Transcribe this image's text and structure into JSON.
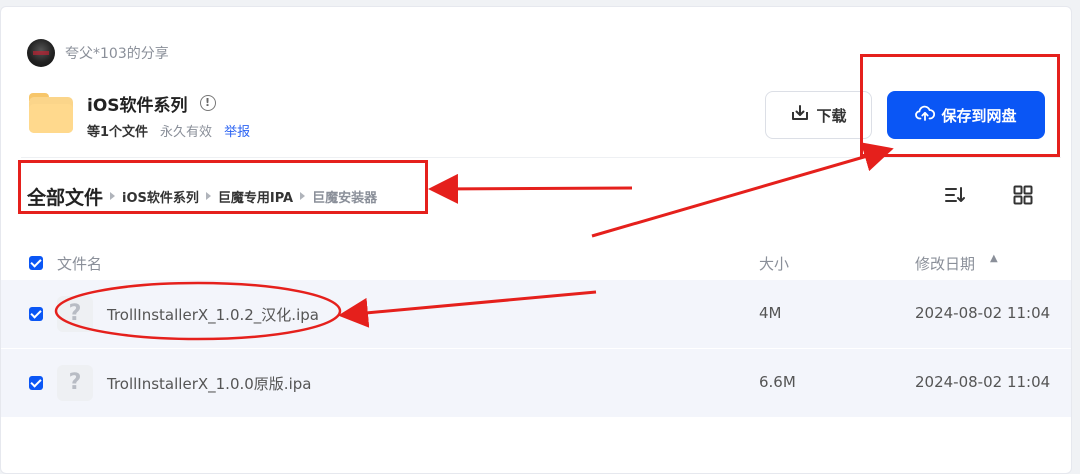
{
  "sharer": {
    "name": "夸父*103的分享"
  },
  "folder": {
    "title": "iOS软件系列",
    "file_count": "等1个文件",
    "validity": "永久有效",
    "report": "举报"
  },
  "actions": {
    "download_label": "下载",
    "save_label": "保存到网盘"
  },
  "breadcrumb": {
    "root": "全部文件",
    "items": [
      "iOS软件系列",
      "巨魔专用IPA",
      "巨魔安装器"
    ]
  },
  "table": {
    "headers": {
      "name": "文件名",
      "size": "大小",
      "date": "修改日期"
    },
    "rows": [
      {
        "name": "TrollInstallerX_1.0.2_汉化.ipa",
        "size": "4M",
        "date": "2024-08-02 11:04",
        "checked": true
      },
      {
        "name": "TrollInstallerX_1.0.0原版.ipa",
        "size": "6.6M",
        "date": "2024-08-02 11:04",
        "checked": true
      }
    ]
  },
  "colors": {
    "accent": "#0a56f5",
    "annotation": "#e5201c",
    "row_bg": "#f3f5fb"
  },
  "icons": [
    "avatar",
    "folder-icon",
    "info-icon",
    "download-icon",
    "cloud-upload-icon",
    "sort-icon",
    "grid-view-icon",
    "unknown-file-icon",
    "checkbox-icon"
  ]
}
